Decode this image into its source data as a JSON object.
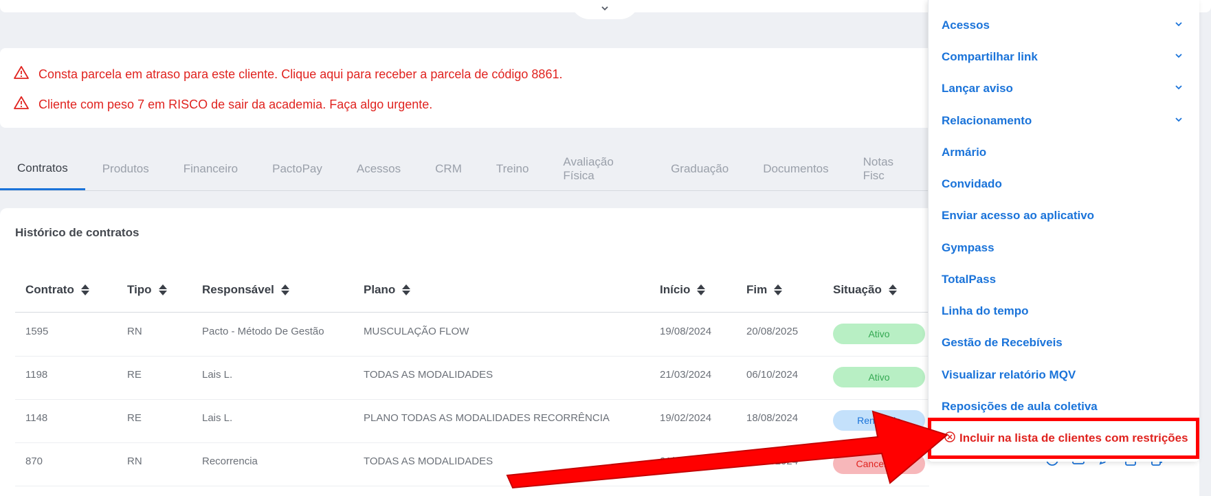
{
  "alerts": [
    {
      "text": "Consta parcela em atraso para este cliente. Clique aqui para receber a parcela de código 8861."
    },
    {
      "text": "Cliente com peso 7 em RISCO de sair da academia. Faça algo urgente."
    }
  ],
  "tabs": [
    "Contratos",
    "Produtos",
    "Financeiro",
    "PactoPay",
    "Acessos",
    "CRM",
    "Treino",
    "Avaliação Física",
    "Graduação",
    "Documentos",
    "Notas Fisc"
  ],
  "card": {
    "title": "Histórico de contratos"
  },
  "table": {
    "headers": [
      "Contrato",
      "Tipo",
      "Responsável",
      "Plano",
      "Início",
      "Fim",
      "Situação"
    ],
    "rows": [
      {
        "contrato": "1595",
        "tipo": "RN",
        "responsavel": "Pacto - Método De Gestão",
        "plano": "MUSCULAÇÃO FLOW",
        "inicio": "19/08/2024",
        "fim": "20/08/2025",
        "situacao": "Ativo"
      },
      {
        "contrato": "1198",
        "tipo": "RE",
        "responsavel": "Lais L.",
        "plano": "TODAS AS MODALIDADES",
        "inicio": "21/03/2024",
        "fim": "06/10/2024",
        "situacao": "Ativo"
      },
      {
        "contrato": "1148",
        "tipo": "RE",
        "responsavel": "Lais L.",
        "plano": "PLANO TODAS AS MODALIDADES RECORRÊNCIA",
        "inicio": "19/02/2024",
        "fim": "18/08/2024",
        "situacao": "Renovado"
      },
      {
        "contrato": "870",
        "tipo": "RN",
        "responsavel": "Recorrencia",
        "plano": "TODAS AS MODALIDADES",
        "inicio": "21/10/2023",
        "fim": "24/01/2024",
        "situacao": "Cancelado"
      }
    ]
  },
  "menu": {
    "items": [
      {
        "label": "Acessos",
        "has_submenu": true
      },
      {
        "label": "Compartilhar link",
        "has_submenu": true
      },
      {
        "label": "Lançar aviso",
        "has_submenu": true
      },
      {
        "label": "Relacionamento",
        "has_submenu": true
      },
      {
        "label": "Armário",
        "has_submenu": false
      },
      {
        "label": "Convidado",
        "has_submenu": false
      },
      {
        "label": "Enviar acesso ao aplicativo",
        "has_submenu": false
      },
      {
        "label": "Gympass",
        "has_submenu": false
      },
      {
        "label": "TotalPass",
        "has_submenu": false
      },
      {
        "label": "Linha do tempo",
        "has_submenu": false
      },
      {
        "label": "Gestão de Recebíveis",
        "has_submenu": false
      },
      {
        "label": "Visualizar relatório MQV",
        "has_submenu": false
      },
      {
        "label": "Reposições de aula coletiva",
        "has_submenu": false
      }
    ],
    "highlighted_item": {
      "label": "Incluir na lista de clientes com restrições"
    }
  },
  "colors": {
    "accent": "#1a73d9",
    "danger": "#e0231f",
    "highlight": "#ff0000",
    "badge_ativo_bg": "#b8efc4",
    "badge_renovado_bg": "#c4e1fb",
    "badge_cancelado_bg": "#f7b7ba"
  }
}
